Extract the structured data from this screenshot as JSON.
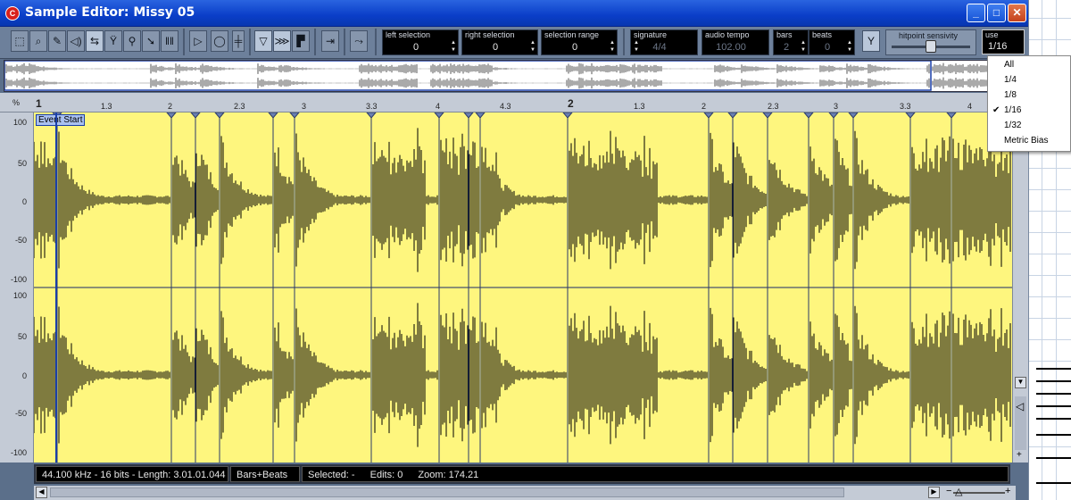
{
  "window": {
    "title": "Sample Editor: Missy 05"
  },
  "titlebar_buttons": {
    "minimize": "_",
    "maximize": "□",
    "close": "✕"
  },
  "toolbar": {
    "tools": [
      "range-select-icon",
      "zoom-icon",
      "pencil-icon",
      "speaker-icon",
      "hitpoint-edit-icon",
      "hitpoint-filter-icon",
      "scrub-icon",
      "select-icon",
      "grid-icon",
      "play-icon",
      "loop-icon",
      "snap-icon",
      "show-hitpoints-icon",
      "show-warp-icon",
      "show-regions-icon",
      "snap-to-zero-icon",
      "link-icon"
    ],
    "left_selection": {
      "label": "left selection",
      "value": "0"
    },
    "right_selection": {
      "label": "right selection",
      "value": "0"
    },
    "selection_range": {
      "label": "selection range",
      "value": "0"
    },
    "signature": {
      "label": "signature",
      "value": "4/4"
    },
    "audio_tempo": {
      "label": "audio tempo",
      "value": "102.00"
    },
    "bars": {
      "label": "bars",
      "value": "2"
    },
    "beats": {
      "label": "beats",
      "value": "0"
    },
    "hitpoint_sensivity": {
      "label": "hitpoint sensivity",
      "level": 0.5
    },
    "use": {
      "label": "use",
      "value": "1/16"
    }
  },
  "ruler": {
    "percent_label": "%",
    "ticks": [
      "1",
      "1.3",
      "2",
      "2.3",
      "3",
      "3.3",
      "4",
      "4.3",
      "2",
      "1.3",
      "2",
      "2.3",
      "3",
      "3.3",
      "4"
    ]
  },
  "event_label": "Event Start",
  "scale": [
    "100",
    "50",
    "0",
    "-50",
    "-100",
    "100",
    "50",
    "0",
    "-50",
    "-100"
  ],
  "status": {
    "info": "44.100 kHz - 16 bits - Length: 3.01.01.044",
    "format": "Bars+Beats",
    "selected": "Selected: -",
    "edits": "Edits: 0",
    "zoom": "Zoom: 174.21"
  },
  "use_menu": {
    "items": [
      "All",
      "1/4",
      "1/8",
      "1/16",
      "1/32",
      "Metric Bias"
    ],
    "checked": "1/16"
  },
  "colors": {
    "waveform_bg": "#fef67e",
    "titlebar": "#0a3ec8"
  }
}
